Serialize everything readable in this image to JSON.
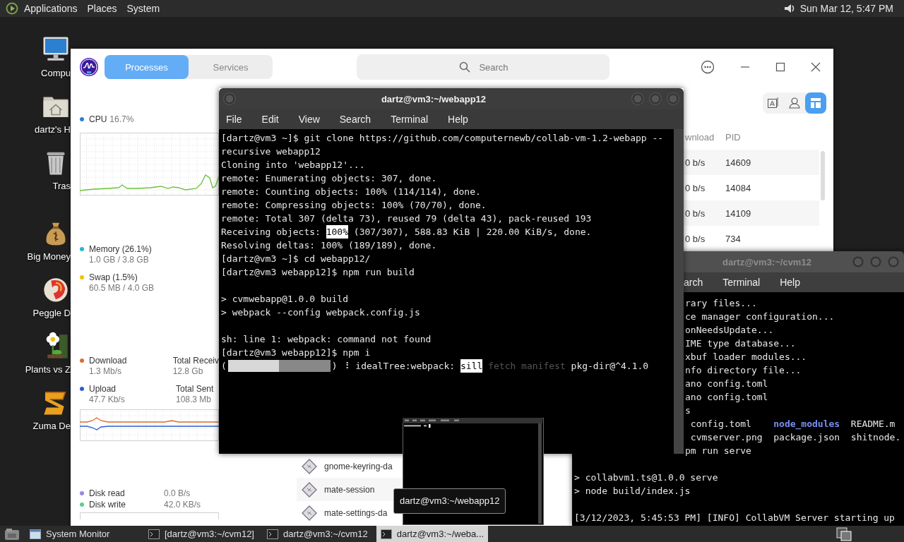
{
  "top_panel": {
    "menus": [
      "Applications",
      "Places",
      "System"
    ],
    "clock": "Sun Mar 12, 5:47 PM"
  },
  "desktop_icons": [
    {
      "label": "Compu",
      "kind": "computer"
    },
    {
      "label": "dartz's H",
      "kind": "home"
    },
    {
      "label": "Tras",
      "kind": "trash"
    },
    {
      "label": "Big Money",
      "kind": "money"
    },
    {
      "label": "Peggle D",
      "kind": "ball"
    },
    {
      "label": "Plants vs Z",
      "kind": "flower"
    },
    {
      "label": "Zuma De",
      "kind": "blocks"
    }
  ],
  "system_monitor": {
    "tabs": [
      {
        "label": "Processes",
        "selected": true
      },
      {
        "label": "Services",
        "selected": false
      }
    ],
    "search": {
      "placeholder": "Search"
    },
    "cpu": {
      "label": "CPU",
      "value": "16.7%",
      "color": "#2f7fd8"
    },
    "memory": [
      {
        "label": "Memory (26.1%)",
        "value": "1.0 GB / 3.8 GB",
        "color": "#29b5c9"
      },
      {
        "label": "Swap (1.5%)",
        "value": "60.5 MB / 4.0 GB",
        "color": "#f2c300"
      }
    ],
    "network": [
      {
        "label": "Download",
        "value": "1.3 Mb/s",
        "color": "#e06a2e",
        "total_label": "Total Receiv",
        "total": "12.8 Gb"
      },
      {
        "label": "Upload",
        "value": "47.7 Kb/s",
        "color": "#2a5fcf",
        "total_label": "Total Sent",
        "total": "108.3 Mb"
      }
    ],
    "disk": [
      {
        "label": "Disk read",
        "value": "0.0 B/s",
        "color": "#9b87e6"
      },
      {
        "label": "Disk write",
        "value": "42.0 KB/s",
        "color": "#5ccf8f"
      }
    ],
    "view_buttons": [
      {
        "kind": "text",
        "selected": false
      },
      {
        "kind": "user",
        "selected": false
      },
      {
        "kind": "tree",
        "selected": true
      }
    ],
    "columns": [
      "wnload",
      "PID"
    ],
    "rows": [
      {
        "download": "0 b/s",
        "pid": "14609"
      },
      {
        "download": "0 b/s",
        "pid": "14084"
      },
      {
        "download": "0 b/s",
        "pid": "14109"
      },
      {
        "download": "0 b/s",
        "pid": "734"
      }
    ],
    "lower_rows": [
      {
        "name": "gnome-keyring-da"
      },
      {
        "name": "mate-session"
      },
      {
        "name": "mate-settings-da"
      }
    ]
  },
  "webapp_terminal": {
    "title": "dartz@vm3:~/webapp12",
    "active": true,
    "menu": [
      "File",
      "Edit",
      "View",
      "Search",
      "Terminal",
      "Help"
    ],
    "blocks": [
      [
        "[dartz@vm3 ~]$ git clone https://github.com/computernewb/collab-vm-1.2-webapp --",
        "recursive webapp12",
        "Cloning into 'webapp12'...",
        "remote: Enumerating objects: 307, done.",
        "remote: Counting objects: 100% (114/114), done.",
        "remote: Compressing objects: 100% (70/70), done.",
        "remote: Total 307 (delta 73), reused 79 (delta 43), pack-reused 193",
        [
          "Receiving objects: ",
          {
            "kind": "highlight",
            "text": "100%"
          },
          " (307/307), 588.83 KiB | 220.00 KiB/s, done."
        ],
        "Resolving deltas: 100% (189/189), done.",
        "[dartz@vm3 ~]$ cd webapp12/",
        "[dartz@vm3 webapp12]$ npm run build"
      ],
      [
        "> cvmwebapp@1.0.0 build",
        "> webpack --config webpack.config.js"
      ],
      [
        "sh: line 1: webpack: command not found",
        "[dartz@vm3 webapp12]$ npm i",
        [
          "(",
          {
            "kind": "progress",
            "level": 0.5
          },
          ") ⠸ idealTree:webpack: ",
          {
            "kind": "highlight",
            "text": "sill"
          },
          {
            "kind": "dim",
            "text": " fetch manifest "
          },
          "pkg-dir@^4.1.0"
        ]
      ]
    ]
  },
  "cvm_terminal": {
    "title": "dartz@vm3:~/cvm12",
    "active": false,
    "menu": [
      "arch",
      "Terminal",
      "Help"
    ],
    "covered_lines": [
      "rary files...",
      "ce manager configuration...",
      "onNeedsUpdate...",
      "IME type database...",
      "xbuf loader modules...",
      "nfo directory file...",
      "ano config.toml",
      "ano config.toml",
      "s",
      [
        " config.toml    ",
        {
          "kind": "dir",
          "text": "node_modules"
        },
        "  README.m"
      ],
      [
        " cvmserver.png  package.json  shitnode."
      ],
      "pm run serve"
    ],
    "blocks": [
      [
        "> collabvm1.ts@1.0.0 serve",
        "> node build/index.js"
      ],
      [
        "[3/12/2023, 5:45:53 PM] [INFO] CollabVM Server starting up"
      ]
    ]
  },
  "tooltip": "dartz@vm3:~/webapp12",
  "taskbar": {
    "items": [
      {
        "label": "System Monitor",
        "kind": "monitor",
        "selected": false
      },
      {
        "label": "[dartz@vm3:~/cvm12]",
        "kind": "terminal",
        "selected": false
      },
      {
        "label": "dartz@vm3:~/cvm12",
        "kind": "terminal",
        "selected": false
      },
      {
        "label": "dartz@vm3:~/weba...",
        "kind": "terminal",
        "selected": true
      }
    ]
  }
}
